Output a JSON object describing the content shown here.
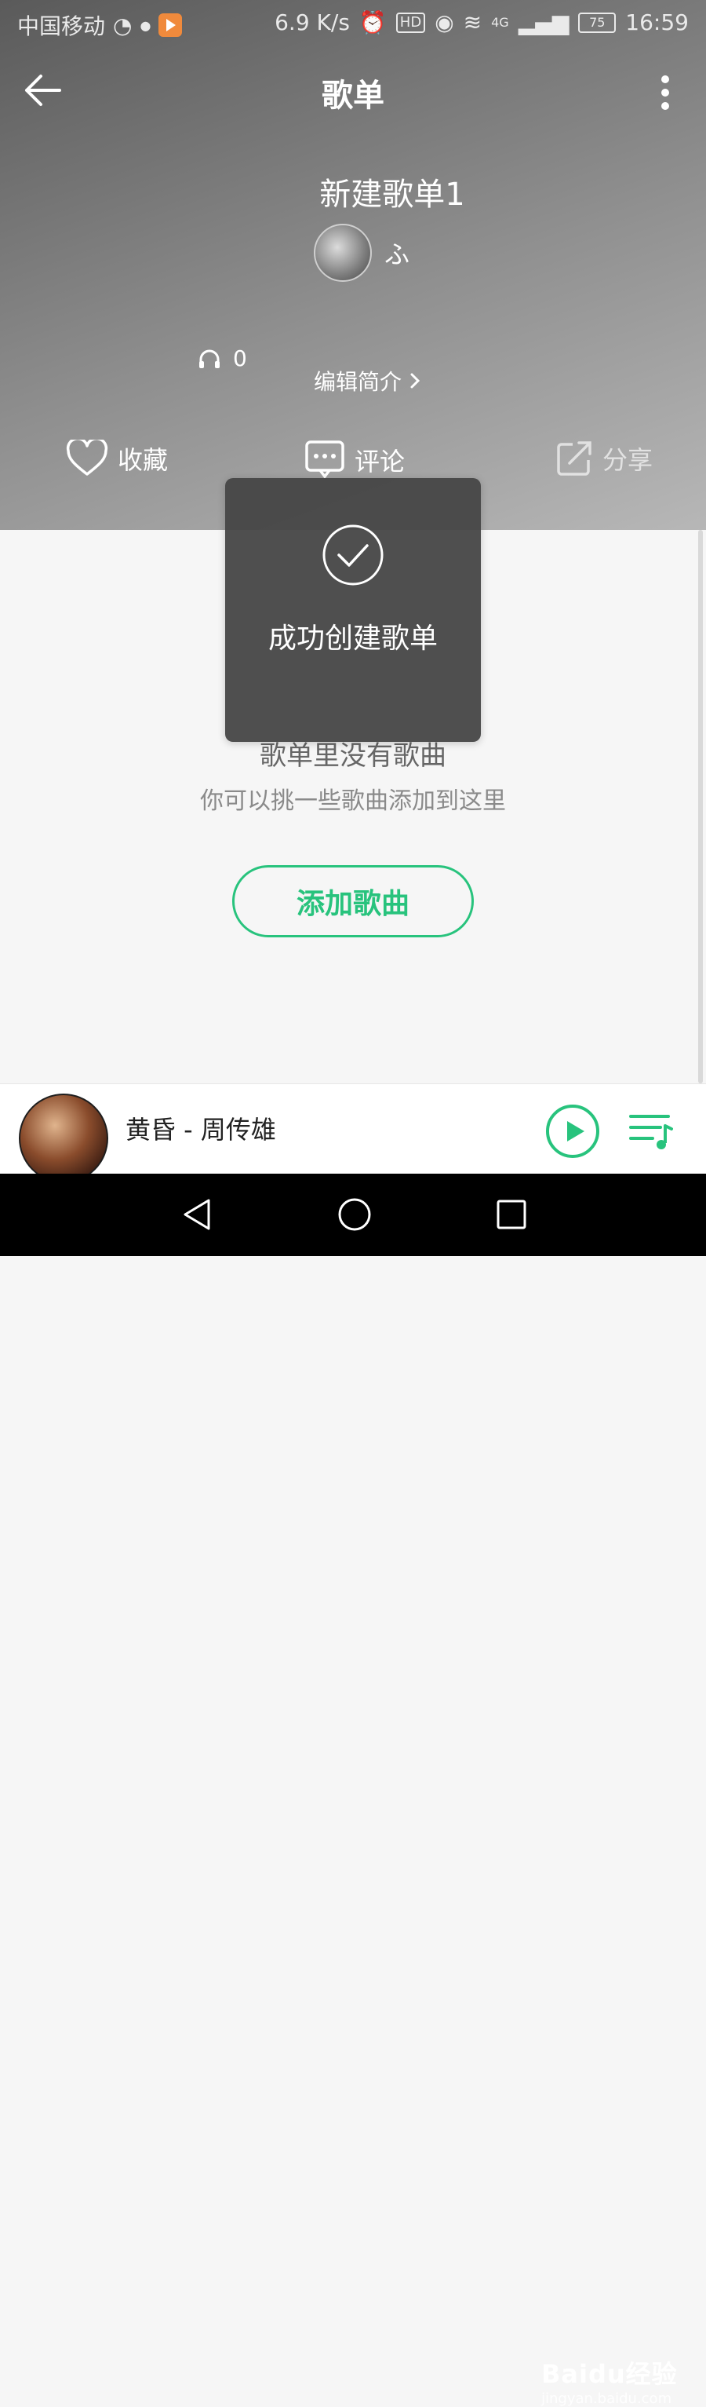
{
  "status_bar": {
    "carrier": "中国移动",
    "speed": "6.9 K/s",
    "hd": "HD",
    "network": "4G",
    "battery": "75",
    "time": "16:59"
  },
  "nav": {
    "title": "歌单"
  },
  "playlist": {
    "title": "新建歌单1",
    "owner_name": "ふ",
    "listen_count": "0",
    "edit_intro": "编辑简介"
  },
  "actions": {
    "favorite": "收藏",
    "comment": "评论",
    "share": "分享"
  },
  "empty_state": {
    "title": "歌单里没有歌曲",
    "subtitle": "你可以挑一些歌曲添加到这里",
    "add_button": "添加歌曲"
  },
  "toast": {
    "message": "成功创建歌单"
  },
  "mini_player": {
    "song": "黄昏 - 周传雄"
  },
  "watermark": {
    "brand": "Baidu经验",
    "url": "jingyan.baidu.com"
  },
  "colors": {
    "accent": "#28c37d"
  },
  "icons": {
    "back": "arrow-left-icon",
    "more": "more-vertical-icon",
    "favorite": "heart-icon",
    "comment": "comment-icon",
    "share": "share-icon",
    "headphones": "headphones-icon",
    "check": "check-circle-icon",
    "play": "play-icon",
    "queue": "playlist-icon"
  }
}
